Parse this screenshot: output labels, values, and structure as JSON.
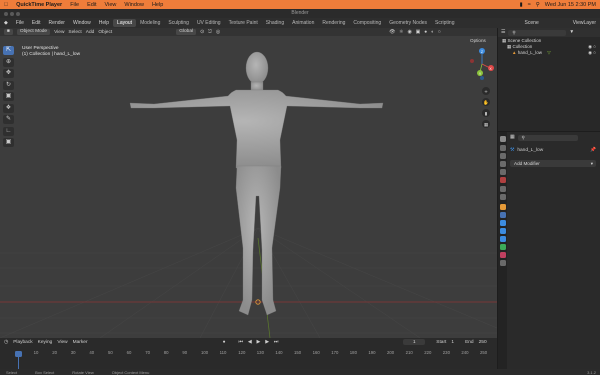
{
  "mac_menu": {
    "app_name": "QuickTime Player",
    "items": [
      "File",
      "Edit",
      "View",
      "Window",
      "Help"
    ],
    "datetime": "Wed Jun 15  2:30 PM"
  },
  "window_title": "Blender",
  "blender_menu": {
    "items": [
      "File",
      "Edit",
      "Render",
      "Window",
      "Help"
    ],
    "workspaces": [
      "Layout",
      "Modeling",
      "Sculpting",
      "UV Editing",
      "Texture Paint",
      "Shading",
      "Animation",
      "Rendering",
      "Compositing",
      "Geometry Nodes",
      "Scripting"
    ],
    "active_workspace": "Layout",
    "scene": "Scene",
    "view_layer": "ViewLayer"
  },
  "viewport": {
    "mode": "Object Mode",
    "menus": [
      "View",
      "Select",
      "Add",
      "Object"
    ],
    "transform_orientation": "Global",
    "options_label": "Options",
    "info_line1": "User Perspective",
    "info_line2": "(1) Collection | hand_L_low",
    "tools": [
      "select-box",
      "cursor",
      "move",
      "rotate",
      "scale",
      "transform",
      "annotate",
      "measure",
      "add-cube"
    ],
    "active_tool": "select-box",
    "gizmo_axes": [
      "X",
      "Y",
      "Z"
    ]
  },
  "timeline": {
    "menus": [
      "Playback",
      "Keying",
      "View",
      "Marker"
    ],
    "current_frame": "1",
    "start_label": "Start",
    "start_value": "1",
    "end_label": "End",
    "end_value": "250",
    "ruler_ticks": [
      "1",
      "10",
      "20",
      "30",
      "40",
      "50",
      "60",
      "70",
      "80",
      "90",
      "100",
      "110",
      "120",
      "130",
      "140",
      "150",
      "160",
      "170",
      "180",
      "190",
      "200",
      "210",
      "220",
      "230",
      "240",
      "250"
    ]
  },
  "statusbar": {
    "items": [
      "Select",
      "Box Select",
      "Rotate View",
      "Object Context Menu"
    ],
    "version": "3.1.2"
  },
  "outliner": {
    "root": "Scene Collection",
    "collection": "Collection",
    "object": "hand_L_low"
  },
  "properties": {
    "object_name": "hand_L_low",
    "add_modifier_label": "Add Modifier"
  },
  "colors": {
    "mac_bar": "#ef7d3a",
    "active_tab": "#4772b3",
    "axis_x": "#e04848",
    "axis_y": "#8cc43c",
    "axis_z": "#3c8ce0"
  }
}
